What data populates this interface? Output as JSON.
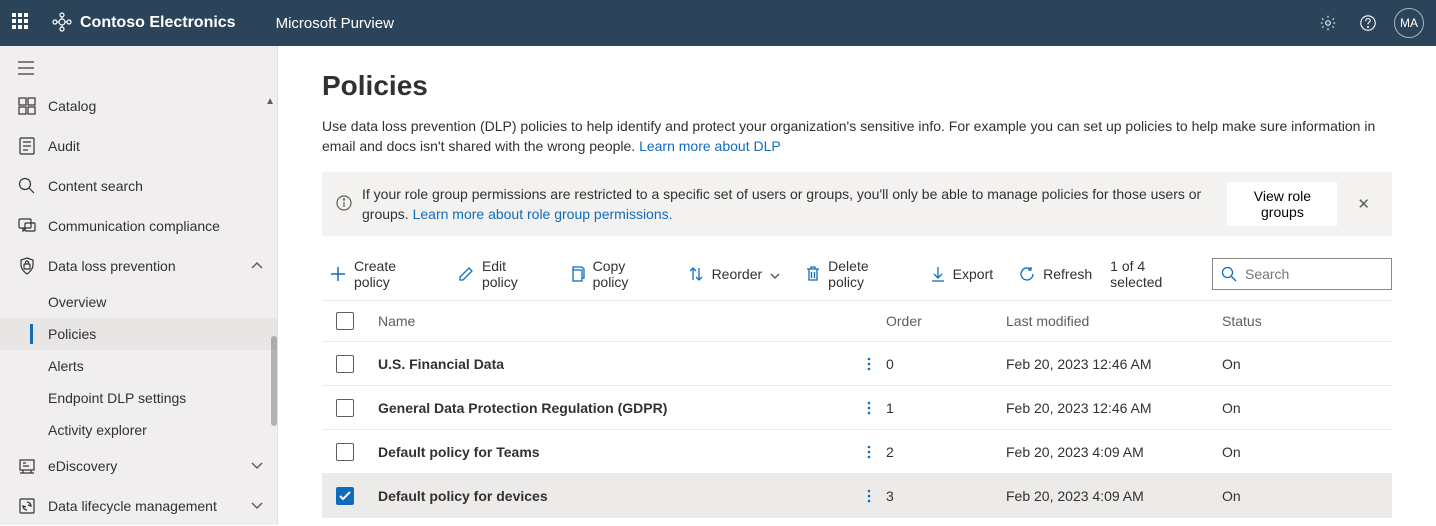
{
  "header": {
    "tenant": "Contoso Electronics",
    "product": "Microsoft Purview",
    "avatar": "MA"
  },
  "sidebar": {
    "items": [
      {
        "icon": "catalog",
        "label": "Catalog"
      },
      {
        "icon": "audit",
        "label": "Audit"
      },
      {
        "icon": "search",
        "label": "Content search"
      },
      {
        "icon": "comm",
        "label": "Communication compliance"
      },
      {
        "icon": "dlp",
        "label": "Data loss prevention",
        "expanded": true,
        "children": [
          {
            "label": "Overview"
          },
          {
            "label": "Policies",
            "active": true
          },
          {
            "label": "Alerts"
          },
          {
            "label": "Endpoint DLP settings"
          },
          {
            "label": "Activity explorer"
          }
        ]
      },
      {
        "icon": "ediscovery",
        "label": "eDiscovery",
        "chevron": "down"
      },
      {
        "icon": "lifecycle",
        "label": "Data lifecycle management",
        "chevron": "down"
      }
    ]
  },
  "page": {
    "title": "Policies",
    "desc_pre": "Use data loss prevention (DLP) policies to help identify and protect your organization's sensitive info. For example you can set up policies to help make sure information in email and docs isn't shared with the wrong people. ",
    "desc_link": "Learn more about DLP",
    "info_text_pre": "If your role group permissions are restricted to a specific set of users or groups, you'll only be able to manage policies for those users or groups.  ",
    "info_link": "Learn more about role group permissions.",
    "view_btn": "View role groups"
  },
  "toolbar": {
    "create": "Create policy",
    "edit": "Edit policy",
    "copy": "Copy policy",
    "reorder": "Reorder",
    "delete": "Delete policy",
    "export": "Export",
    "refresh": "Refresh",
    "selected": "1 of 4 selected",
    "search_placeholder": "Search"
  },
  "table": {
    "headers": {
      "name": "Name",
      "order": "Order",
      "modified": "Last modified",
      "status": "Status"
    },
    "rows": [
      {
        "name": "U.S. Financial Data",
        "order": "0",
        "modified": "Feb 20, 2023 12:46 AM",
        "status": "On",
        "checked": false
      },
      {
        "name": "General Data Protection Regulation (GDPR)",
        "order": "1",
        "modified": "Feb 20, 2023 12:46 AM",
        "status": "On",
        "checked": false
      },
      {
        "name": "Default policy for Teams",
        "order": "2",
        "modified": "Feb 20, 2023 4:09 AM",
        "status": "On",
        "checked": false
      },
      {
        "name": "Default policy for devices",
        "order": "3",
        "modified": "Feb 20, 2023 4:09 AM",
        "status": "On",
        "checked": true
      }
    ]
  }
}
